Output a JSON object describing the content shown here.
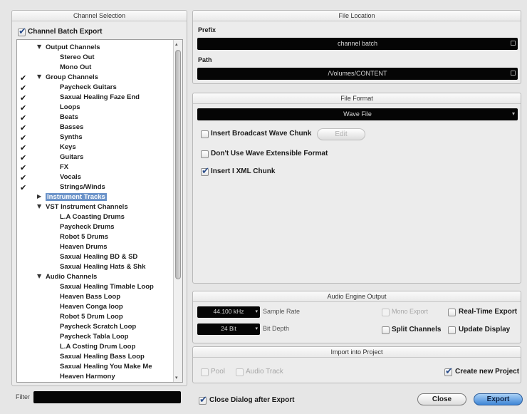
{
  "channel_selection": {
    "title": "Channel Selection",
    "batch_export_label": "Channel Batch Export",
    "batch_export_checked": true,
    "filter_label": "Filter",
    "filter_value": "",
    "rows": [
      {
        "indent": 1,
        "expander": "open",
        "label": "Output Channels",
        "checked": false
      },
      {
        "indent": 2,
        "expander": "",
        "label": "Stereo Out",
        "checked": false
      },
      {
        "indent": 2,
        "expander": "",
        "label": "Mono Out",
        "checked": false
      },
      {
        "indent": 1,
        "expander": "open",
        "label": "Group Channels",
        "checked": true
      },
      {
        "indent": 2,
        "expander": "",
        "label": "Paycheck Guitars",
        "checked": true
      },
      {
        "indent": 2,
        "expander": "",
        "label": "Saxual Healing Faze End",
        "checked": true
      },
      {
        "indent": 2,
        "expander": "",
        "label": "Loops",
        "checked": true
      },
      {
        "indent": 2,
        "expander": "",
        "label": "Beats",
        "checked": true
      },
      {
        "indent": 2,
        "expander": "",
        "label": "Basses",
        "checked": true
      },
      {
        "indent": 2,
        "expander": "",
        "label": "Synths",
        "checked": true
      },
      {
        "indent": 2,
        "expander": "",
        "label": "Keys",
        "checked": true
      },
      {
        "indent": 2,
        "expander": "",
        "label": "Guitars",
        "checked": true
      },
      {
        "indent": 2,
        "expander": "",
        "label": "FX",
        "checked": true
      },
      {
        "indent": 2,
        "expander": "",
        "label": "Vocals",
        "checked": true
      },
      {
        "indent": 2,
        "expander": "",
        "label": "Strings/Winds",
        "checked": true
      },
      {
        "indent": 1,
        "expander": "closed",
        "label": "Instrument Tracks",
        "checked": false,
        "selected": true
      },
      {
        "indent": 1,
        "expander": "open",
        "label": "VST Instrument Channels",
        "checked": false
      },
      {
        "indent": 2,
        "expander": "",
        "label": "L.A Coasting Drums",
        "checked": false
      },
      {
        "indent": 2,
        "expander": "",
        "label": "Paycheck Drums",
        "checked": false
      },
      {
        "indent": 2,
        "expander": "",
        "label": "Robot 5 Drums",
        "checked": false
      },
      {
        "indent": 2,
        "expander": "",
        "label": "Heaven Drums",
        "checked": false
      },
      {
        "indent": 2,
        "expander": "",
        "label": "Saxual Healing BD & SD",
        "checked": false
      },
      {
        "indent": 2,
        "expander": "",
        "label": "Saxual Healing Hats & Shk",
        "checked": false
      },
      {
        "indent": 1,
        "expander": "open",
        "label": "Audio Channels",
        "checked": false
      },
      {
        "indent": 2,
        "expander": "",
        "label": "Saxual Healing Timable Loop",
        "checked": false
      },
      {
        "indent": 2,
        "expander": "",
        "label": "Heaven Bass Loop",
        "checked": false
      },
      {
        "indent": 2,
        "expander": "",
        "label": "Heaven Conga loop",
        "checked": false
      },
      {
        "indent": 2,
        "expander": "",
        "label": "Robot 5 Drum Loop",
        "checked": false
      },
      {
        "indent": 2,
        "expander": "",
        "label": "Paycheck Scratch Loop",
        "checked": false
      },
      {
        "indent": 2,
        "expander": "",
        "label": "Paycheck Tabla Loop",
        "checked": false
      },
      {
        "indent": 2,
        "expander": "",
        "label": "L.A Costing Drum Loop",
        "checked": false
      },
      {
        "indent": 2,
        "expander": "",
        "label": "Saxual Healing Bass Loop",
        "checked": false
      },
      {
        "indent": 2,
        "expander": "",
        "label": "Saxual Healing You Make Me",
        "checked": false
      },
      {
        "indent": 2,
        "expander": "",
        "label": "Heaven Harmony",
        "checked": false
      }
    ]
  },
  "file_location": {
    "title": "File Location",
    "prefix_label": "Prefix",
    "prefix_value": "channel batch",
    "path_label": "Path",
    "path_value": "/Volumes/CONTENT"
  },
  "file_format": {
    "title": "File Format",
    "format_value": "Wave File",
    "broadcast_label": "Insert Broadcast Wave Chunk",
    "broadcast_checked": false,
    "edit_label": "Edit",
    "wave_ext_label": "Don't Use Wave Extensible Format",
    "wave_ext_checked": false,
    "ixml_label": "Insert I XML Chunk",
    "ixml_checked": true
  },
  "audio_engine": {
    "title": "Audio Engine Output",
    "sample_rate_value": "44.100 kHz",
    "sample_rate_label": "Sample Rate",
    "bit_depth_value": "24 Bit",
    "bit_depth_label": "Bit Depth",
    "mono_export_label": "Mono Export",
    "realtime_label": "Real-Time Export",
    "split_label": "Split Channels",
    "update_label": "Update Display"
  },
  "import_project": {
    "title": "Import into Project",
    "pool_label": "Pool",
    "audio_track_label": "Audio Track",
    "create_label": "Create new Project",
    "create_checked": true
  },
  "footer": {
    "close_after_label": "Close Dialog after Export",
    "close_after_checked": true,
    "close_button": "Close",
    "export_button": "Export"
  }
}
